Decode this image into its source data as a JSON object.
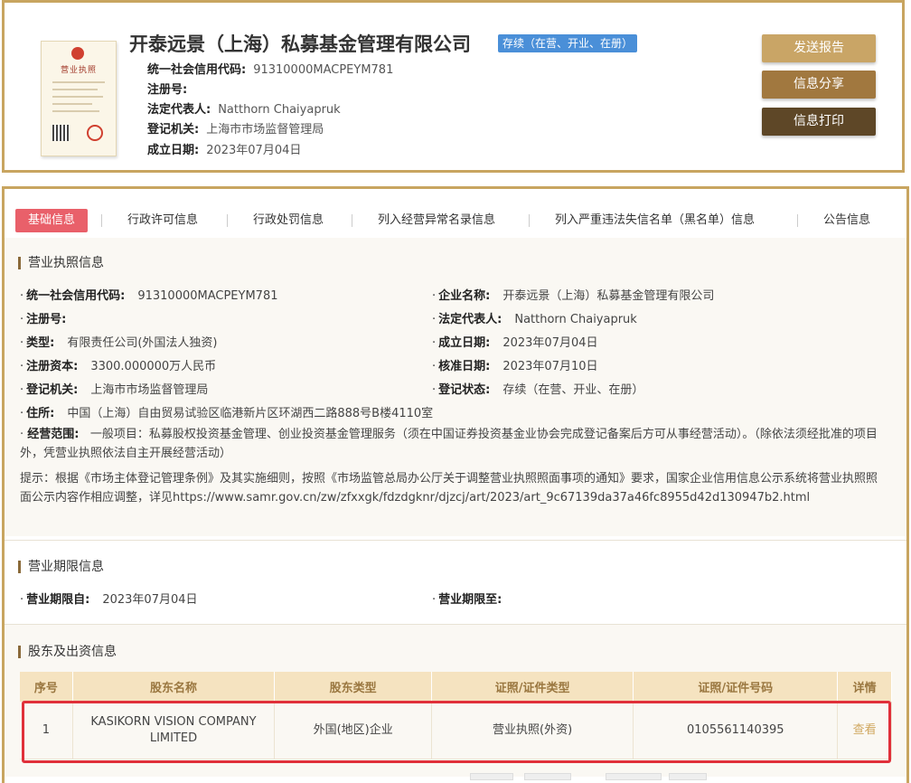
{
  "header": {
    "company_name": "开泰远景（上海）私募基金管理有限公司",
    "status_badge": "存续（在营、开业、在册）",
    "fields": [
      {
        "label": "统一社会信用代码:",
        "value": "91310000MACPEYM781"
      },
      {
        "label": "注册号:",
        "value": ""
      },
      {
        "label": "法定代表人:",
        "value": "Natthorn Chaiyapruk"
      },
      {
        "label": "登记机关:",
        "value": "上海市市场监督管理局"
      },
      {
        "label": "成立日期:",
        "value": "2023年07月04日"
      }
    ],
    "license_image_title": "营业执照",
    "buttons": {
      "report": "发送报告",
      "share": "信息分享",
      "print": "信息打印"
    }
  },
  "tabs": [
    "基础信息",
    "行政许可信息",
    "行政处罚信息",
    "列入经营异常名录信息",
    "列入严重违法失信名单（黑名单）信息",
    "公告信息"
  ],
  "license_section": {
    "title": "营业执照信息",
    "left": [
      {
        "label": "统一社会信用代码:",
        "value": "91310000MACPEYM781"
      },
      {
        "label": "注册号:",
        "value": ""
      },
      {
        "label": "类型:",
        "value": "有限责任公司(外国法人独资)"
      },
      {
        "label": "注册资本:",
        "value": "3300.000000万人民币"
      },
      {
        "label": "登记机关:",
        "value": "上海市市场监督管理局"
      },
      {
        "label": "住所:",
        "value": "中国（上海）自由贸易试验区临港新片区环湖西二路888号B楼4110室"
      }
    ],
    "right": [
      {
        "label": "企业名称:",
        "value": "开泰远景（上海）私募基金管理有限公司"
      },
      {
        "label": "法定代表人:",
        "value": "Natthorn Chaiyapruk"
      },
      {
        "label": "成立日期:",
        "value": "2023年07月04日"
      },
      {
        "label": "核准日期:",
        "value": "2023年07月10日"
      },
      {
        "label": "登记状态:",
        "value": "存续（在营、开业、在册）"
      }
    ],
    "scope_label": "经营范围:",
    "scope_value": "一般项目：私募股权投资基金管理、创业投资基金管理服务（须在中国证券投资基金业协会完成登记备案后方可从事经营活动）。（除依法须经批准的项目外，凭营业执照依法自主开展经营活动）",
    "hint": "提示：根据《市场主体登记管理条例》及其实施细则，按照《市场监管总局办公厅关于调整营业执照照面事项的通知》要求，国家企业信用信息公示系统将营业执照照面公示内容作相应调整，详见https://www.samr.gov.cn/zw/zfxxgk/fdzdgknr/djzcj/art/2023/art_9c67139da37a46fc8955d42d130947b2.html"
  },
  "term_section": {
    "title": "营业期限信息",
    "from_label": "营业期限自:",
    "from_value": "2023年07月04日",
    "to_label": "营业期限至:",
    "to_value": ""
  },
  "shareholder_section": {
    "title": "股东及出资信息",
    "columns": [
      "序号",
      "股东名称",
      "股东类型",
      "证照/证件类型",
      "证照/证件号码",
      "详情"
    ],
    "rows": [
      {
        "index": "1",
        "name": "KASIKORN VISION COMPANY LIMITED",
        "type": "外国(地区)企业",
        "cert_type": "营业执照(外资)",
        "cert_no": "0105561140395",
        "detail": "查看"
      }
    ]
  }
}
